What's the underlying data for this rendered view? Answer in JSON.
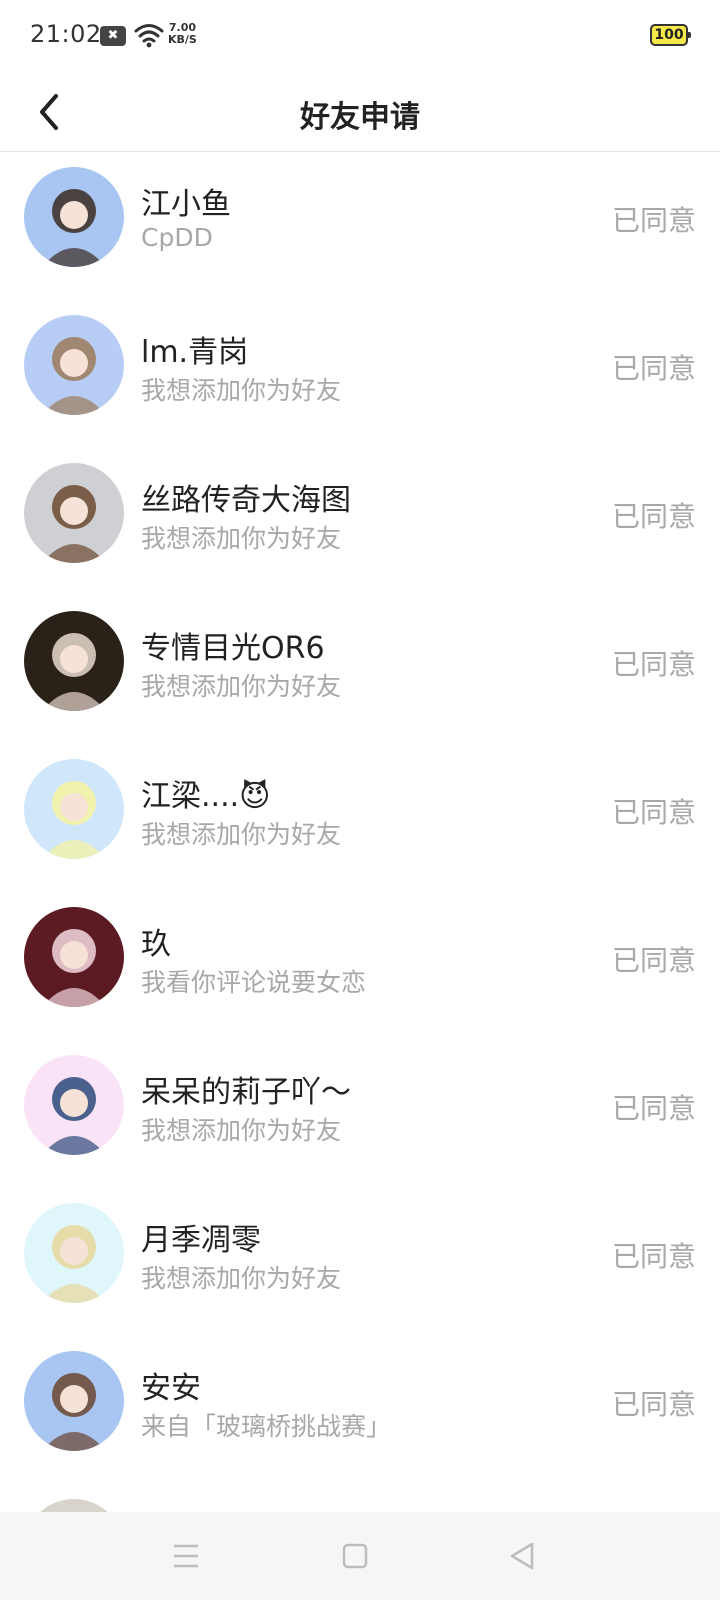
{
  "status_bar": {
    "time": "21:02",
    "notification_glyph": "✖",
    "net_speed_value": "7.00",
    "net_speed_unit": "KB/S",
    "battery": "100"
  },
  "header": {
    "title": "好友申请",
    "back_icon": "chevron-left-icon"
  },
  "requests": [
    {
      "name": "江小鱼",
      "message": "CpDD",
      "status": "已同意",
      "avatar_colors": [
        "#a9c5f2",
        "#3a2a22"
      ]
    },
    {
      "name": "lm.青岗",
      "message": "我想添加你为好友",
      "status": "已同意",
      "avatar_colors": [
        "#b8cdf5",
        "#9b7a5a"
      ]
    },
    {
      "name": "丝路传奇大海图",
      "message": "我想添加你为好友",
      "status": "已同意",
      "avatar_colors": [
        "#cfd0d3",
        "#6b4a30"
      ]
    },
    {
      "name": "专情目光OR6",
      "message": "我想添加你为好友",
      "status": "已同意",
      "avatar_colors": [
        "#2a2118",
        "#e8d9cf"
      ]
    },
    {
      "name": "江梁....😈",
      "message": "我想添加你为好友",
      "status": "已同意",
      "avatar_colors": [
        "#cfe6fb",
        "#f7f3a0"
      ]
    },
    {
      "name": "玖",
      "message": "我看你评论说要女恋",
      "status": "已同意",
      "avatar_colors": [
        "#5c1a22",
        "#f3d9df"
      ]
    },
    {
      "name": "呆呆的莉子吖～",
      "message": "我想添加你为好友",
      "status": "已同意",
      "avatar_colors": [
        "#fbe3f7",
        "#2c4a7a"
      ]
    },
    {
      "name": "月季凋零",
      "message": "我想添加你为好友",
      "status": "已同意",
      "avatar_colors": [
        "#dff6fb",
        "#e8d79a"
      ]
    },
    {
      "name": "安安",
      "message": "来自「玻璃桥挑战赛」",
      "status": "已同意",
      "avatar_colors": [
        "#a9c5f2",
        "#6b4530"
      ]
    },
    {
      "name": "",
      "message": "",
      "status": "",
      "avatar_colors": [
        "#d8d4cc",
        "#8c7b6a"
      ]
    }
  ],
  "nav": {
    "menu_icon": "menu-icon",
    "home_icon": "home-square-icon",
    "back_icon": "back-triangle-icon"
  }
}
